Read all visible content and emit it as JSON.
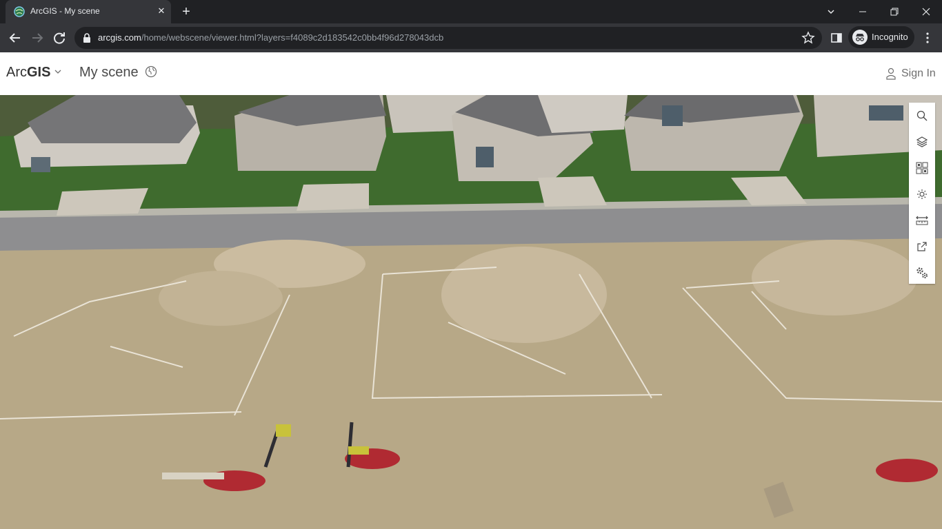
{
  "browser": {
    "tab_title": "ArcGIS - My scene",
    "url_host": "arcgis.com",
    "url_path": "/home/webscene/viewer.html?layers=f4089c2d183542c0bb4f96d278043dcb",
    "incognito_label": "Incognito"
  },
  "app": {
    "brand_light": "Arc",
    "brand_bold": "GIS",
    "scene_title": "My scene",
    "sign_in": "Sign In"
  },
  "tools": [
    "search-icon",
    "layers-icon",
    "basemap-icon",
    "daylight-icon",
    "measure-icon",
    "share-icon",
    "settings-icon"
  ],
  "colors": {
    "chrome_dark": "#202124",
    "chrome_toolbar": "#35363a",
    "header_bg": "#ffffff"
  }
}
